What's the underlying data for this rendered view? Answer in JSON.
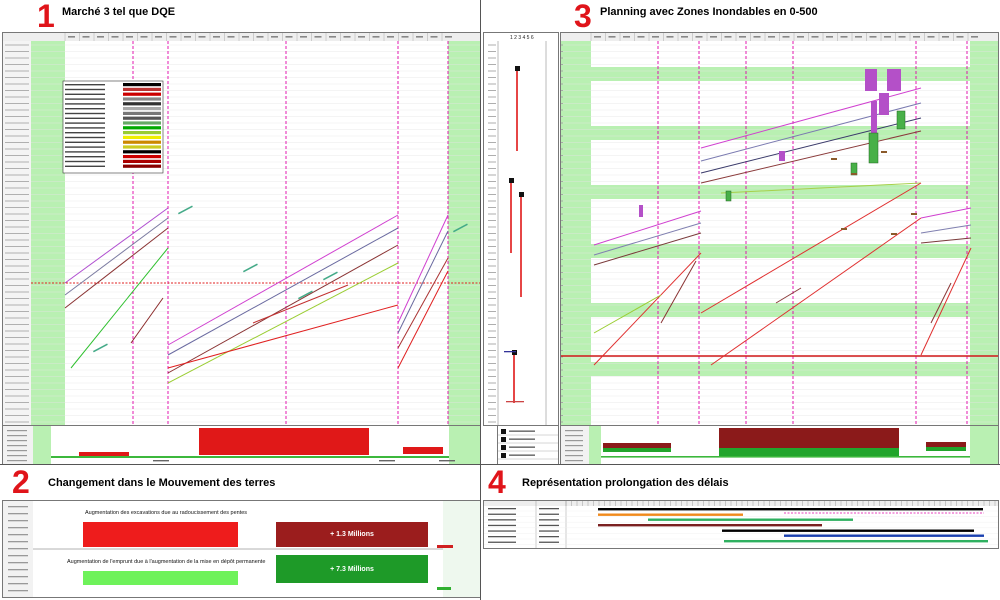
{
  "panels": [
    {
      "number": "1",
      "title": "Marché 3 tel que DQE"
    },
    {
      "number": "2",
      "title": "Changement dans le Mouvement des terres"
    },
    {
      "number": "3",
      "title": "Planning avec Zones Inondables en 0-500"
    },
    {
      "number": "4",
      "title": "Représentation prolongation des délais"
    }
  ],
  "panel2": {
    "row1_label": "Augmentation des excavations due au radoucissement des pentes",
    "row1_value": "+ 1.3 Millions",
    "row2_label": "Augmentation de l'emprunt due à l'augmentation de la mise en dépôt permanente",
    "row2_value": "+ 7.3 Millions"
  },
  "panel3": {
    "strip_header": "1 2 3 4 5 6"
  },
  "colors": {
    "accent_red": "#e0141a",
    "dark_red": "#8b1a1a",
    "green_band": "#b9f0b2",
    "magenta": "#e000a8",
    "bar_green": "#22a52c",
    "light_green": "#6ef25a"
  }
}
